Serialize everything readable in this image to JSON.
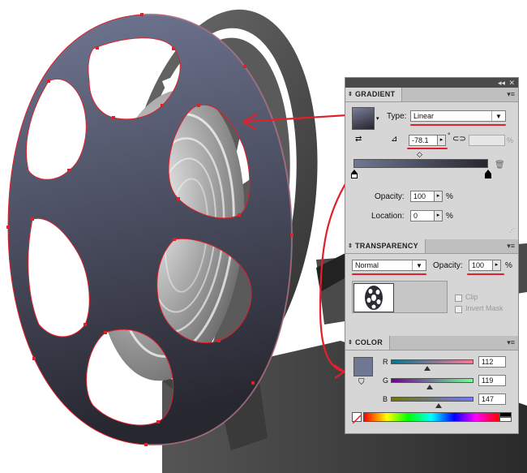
{
  "gradient": {
    "title": "GRADIENT",
    "type_label": "Type:",
    "type_value": "Linear",
    "angle_value": "-78.1",
    "angle_unit": "°",
    "aspect_unit": "%",
    "opacity_label": "Opacity:",
    "opacity_value": "100",
    "opacity_unit": "%",
    "location_label": "Location:",
    "location_value": "0",
    "location_unit": "%",
    "start_color": "#707793",
    "end_color": "#272730"
  },
  "transparency": {
    "title": "TRANSPARENCY",
    "blend_mode": "Normal",
    "opacity_label": "Opacity:",
    "opacity_value": "100",
    "opacity_unit": "%",
    "clip_label": "Clip",
    "invert_mask_label": "Invert Mask"
  },
  "color": {
    "title": "COLOR",
    "r_label": "R",
    "r_value": "112",
    "r_fraction": 0.44,
    "g_label": "G",
    "g_value": "119",
    "g_fraction": 0.47,
    "b_label": "B",
    "b_value": "147",
    "b_fraction": 0.58,
    "fill_color": "#707793"
  },
  "colors": {
    "accent_red": "#e0202a",
    "reel_fill": "#5a5c70"
  }
}
